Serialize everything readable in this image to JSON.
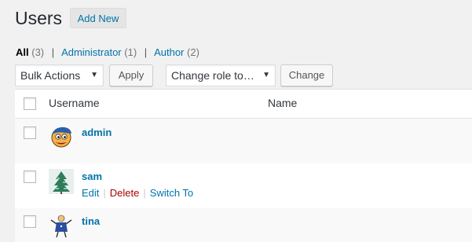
{
  "header": {
    "title": "Users",
    "add_new_label": "Add New"
  },
  "filters": [
    {
      "label": "All",
      "count": "(3)"
    },
    {
      "label": "Administrator",
      "count": "(1)"
    },
    {
      "label": "Author",
      "count": "(2)"
    }
  ],
  "filter_separator": "|",
  "controls": {
    "bulk_actions": "Bulk Actions",
    "apply_label": "Apply",
    "change_role": "Change role to…",
    "change_label": "Change"
  },
  "table": {
    "columns": [
      "Username",
      "Name"
    ],
    "rows": [
      {
        "username": "admin",
        "avatar": "cartoon-face-avatar"
      },
      {
        "username": "sam",
        "avatar": "pine-tree-avatar",
        "actions": [
          "Edit",
          "Delete",
          "Switch To"
        ]
      },
      {
        "username": "tina",
        "avatar": "cartoon-figure-avatar"
      }
    ]
  },
  "colors": {
    "link": "#0073aa",
    "delete": "#aa0000",
    "background": "#f1f1f1"
  }
}
